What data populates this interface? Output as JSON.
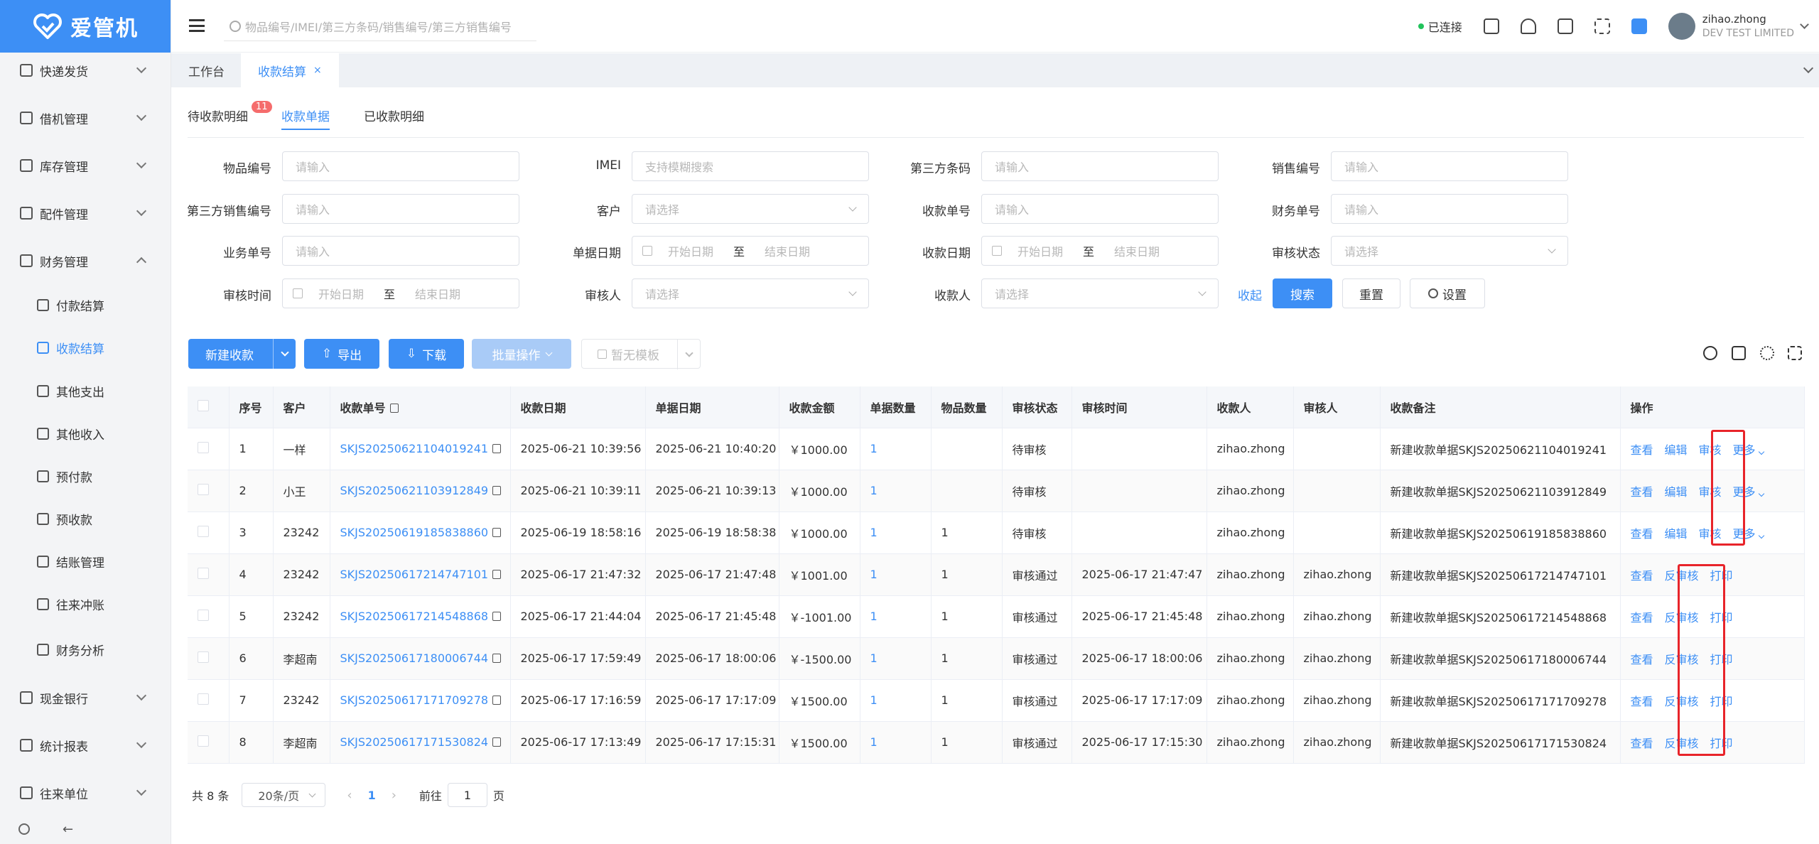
{
  "app": {
    "logo_text": "爱管机"
  },
  "sidebar": {
    "items": [
      {
        "label": "快递发货"
      },
      {
        "label": "借机管理"
      },
      {
        "label": "库存管理"
      },
      {
        "label": "配件管理"
      },
      {
        "label": "财务管理"
      },
      {
        "label": "现金银行"
      },
      {
        "label": "统计报表"
      },
      {
        "label": "往来单位"
      }
    ],
    "finance_children": [
      {
        "label": "付款结算"
      },
      {
        "label": "收款结算"
      },
      {
        "label": "其他支出"
      },
      {
        "label": "其他收入"
      },
      {
        "label": "预付款"
      },
      {
        "label": "预收款"
      },
      {
        "label": "结账管理"
      },
      {
        "label": "往来冲账"
      },
      {
        "label": "财务分析"
      }
    ],
    "footer_back": "←"
  },
  "header": {
    "search_placeholder": "物品编号/IMEI/第三方条码/销售编号/第三方销售编号",
    "status": "已连接",
    "username": "zihao.zhong",
    "company": "DEV TEST LIMITED"
  },
  "tabs": [
    {
      "label": "工作台"
    },
    {
      "label": "收款结算",
      "close": "×"
    }
  ],
  "subtabs": [
    {
      "label": "待收款明细",
      "badge": "11"
    },
    {
      "label": "收款单据"
    },
    {
      "label": "已收款明细"
    }
  ],
  "filters": {
    "item_no": {
      "label": "物品编号",
      "placeholder": "请输入"
    },
    "imei": {
      "label": "IMEI",
      "placeholder": "支持模糊搜索"
    },
    "barcode": {
      "label": "第三方条码",
      "placeholder": "请输入"
    },
    "sales_no": {
      "label": "销售编号",
      "placeholder": "请输入"
    },
    "third_sales_no": {
      "label": "第三方销售编号",
      "placeholder": "请输入"
    },
    "customer": {
      "label": "客户",
      "placeholder": "请选择"
    },
    "receipt_no": {
      "label": "收款单号",
      "placeholder": "请输入"
    },
    "finance_no": {
      "label": "财务单号",
      "placeholder": "请输入"
    },
    "business_no": {
      "label": "业务单号",
      "placeholder": "请输入"
    },
    "doc_date": {
      "label": "单据日期",
      "start": "开始日期",
      "to": "至",
      "end": "结束日期"
    },
    "receipt_date": {
      "label": "收款日期",
      "start": "开始日期",
      "to": "至",
      "end": "结束日期"
    },
    "audit_status": {
      "label": "审核状态",
      "placeholder": "请选择"
    },
    "audit_time": {
      "label": "审核时间",
      "start": "开始日期",
      "to": "至",
      "end": "结束日期"
    },
    "auditor": {
      "label": "审核人",
      "placeholder": "请选择"
    },
    "receiver": {
      "label": "收款人",
      "placeholder": "请选择"
    },
    "collapse": "收起",
    "search_btn": "搜索",
    "reset_btn": "重置",
    "settings_btn": "设置"
  },
  "toolbar": {
    "new_receipt": "新建收款",
    "export": "导出",
    "download": "下载",
    "batch": "批量操作",
    "template": "暂无模板"
  },
  "table": {
    "columns": [
      "序号",
      "客户",
      "收款单号",
      "收款日期",
      "单据日期",
      "收款金额",
      "单据数量",
      "物品数量",
      "审核状态",
      "审核时间",
      "收款人",
      "审核人",
      "收款备注",
      "操作"
    ],
    "rows": [
      {
        "no": "1",
        "customer": "一样",
        "receipt_no": "SKJS20250621104019241",
        "receipt_date": "2025-06-21 10:39:56",
        "doc_date": "2025-06-21 10:40:20",
        "amount": "￥1000.00",
        "doc_qty": "1",
        "item_qty": "",
        "status": "待审核",
        "audit_time": "",
        "receiver": "zihao.zhong",
        "auditor": "",
        "remark": "新建收款单据SKJS20250621104019241",
        "ops": [
          "查看",
          "编辑",
          "审核"
        ],
        "more": "更多"
      },
      {
        "no": "2",
        "customer": "小王",
        "receipt_no": "SKJS20250621103912849",
        "receipt_date": "2025-06-21 10:39:11",
        "doc_date": "2025-06-21 10:39:13",
        "amount": "￥1000.00",
        "doc_qty": "1",
        "item_qty": "",
        "status": "待审核",
        "audit_time": "",
        "receiver": "zihao.zhong",
        "auditor": "",
        "remark": "新建收款单据SKJS20250621103912849",
        "ops": [
          "查看",
          "编辑",
          "审核"
        ],
        "more": "更多"
      },
      {
        "no": "3",
        "customer": "23242",
        "receipt_no": "SKJS20250619185838860",
        "receipt_date": "2025-06-19 18:58:16",
        "doc_date": "2025-06-19 18:58:38",
        "amount": "￥1000.00",
        "doc_qty": "1",
        "item_qty": "1",
        "status": "待审核",
        "audit_time": "",
        "receiver": "zihao.zhong",
        "auditor": "",
        "remark": "新建收款单据SKJS20250619185838860",
        "ops": [
          "查看",
          "编辑",
          "审核"
        ],
        "more": "更多"
      },
      {
        "no": "4",
        "customer": "23242",
        "receipt_no": "SKJS20250617214747101",
        "receipt_date": "2025-06-17 21:47:32",
        "doc_date": "2025-06-17 21:47:48",
        "amount": "￥1001.00",
        "doc_qty": "1",
        "item_qty": "1",
        "status": "审核通过",
        "audit_time": "2025-06-17 21:47:47",
        "receiver": "zihao.zhong",
        "auditor": "zihao.zhong",
        "remark": "新建收款单据SKJS20250617214747101",
        "ops": [
          "查看",
          "反审核",
          "打印"
        ],
        "more": ""
      },
      {
        "no": "5",
        "customer": "23242",
        "receipt_no": "SKJS20250617214548868",
        "receipt_date": "2025-06-17 21:44:04",
        "doc_date": "2025-06-17 21:45:48",
        "amount": "￥-1001.00",
        "doc_qty": "1",
        "item_qty": "1",
        "status": "审核通过",
        "audit_time": "2025-06-17 21:45:48",
        "receiver": "zihao.zhong",
        "auditor": "zihao.zhong",
        "remark": "新建收款单据SKJS20250617214548868",
        "ops": [
          "查看",
          "反审核",
          "打印"
        ],
        "more": ""
      },
      {
        "no": "6",
        "customer": "李超南",
        "receipt_no": "SKJS20250617180006744",
        "receipt_date": "2025-06-17 17:59:49",
        "doc_date": "2025-06-17 18:00:06",
        "amount": "￥-1500.00",
        "doc_qty": "1",
        "item_qty": "1",
        "status": "审核通过",
        "audit_time": "2025-06-17 18:00:06",
        "receiver": "zihao.zhong",
        "auditor": "zihao.zhong",
        "remark": "新建收款单据SKJS20250617180006744",
        "ops": [
          "查看",
          "反审核",
          "打印"
        ],
        "more": ""
      },
      {
        "no": "7",
        "customer": "23242",
        "receipt_no": "SKJS20250617171709278",
        "receipt_date": "2025-06-17 17:16:59",
        "doc_date": "2025-06-17 17:17:09",
        "amount": "￥1500.00",
        "doc_qty": "1",
        "item_qty": "1",
        "status": "审核通过",
        "audit_time": "2025-06-17 17:17:09",
        "receiver": "zihao.zhong",
        "auditor": "zihao.zhong",
        "remark": "新建收款单据SKJS20250617171709278",
        "ops": [
          "查看",
          "反审核",
          "打印"
        ],
        "more": ""
      },
      {
        "no": "8",
        "customer": "李超南",
        "receipt_no": "SKJS20250617171530824",
        "receipt_date": "2025-06-17 17:13:49",
        "doc_date": "2025-06-17 17:15:31",
        "amount": "￥1500.00",
        "doc_qty": "1",
        "item_qty": "1",
        "status": "审核通过",
        "audit_time": "2025-06-17 17:15:30",
        "receiver": "zihao.zhong",
        "auditor": "zihao.zhong",
        "remark": "新建收款单据SKJS20250617171530824",
        "ops": [
          "查看",
          "反审核",
          "打印"
        ],
        "more": ""
      }
    ]
  },
  "pagination": {
    "total": "共 8 条",
    "page_size": "20条/页",
    "current": "1",
    "goto_label": "前往",
    "goto_value": "1",
    "page_suffix": "页"
  },
  "colors": {
    "accent": "#3d8ff5",
    "highlight": "#e8242a"
  }
}
